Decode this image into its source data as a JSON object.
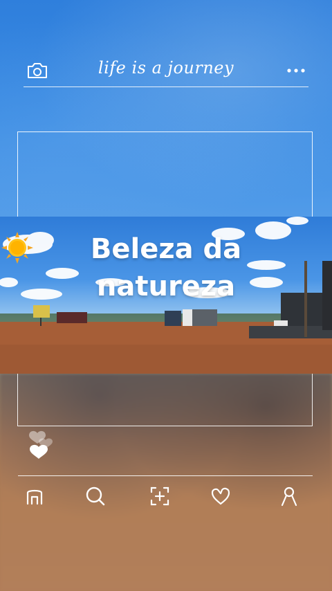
{
  "header": {
    "title": "life is a journey",
    "camera_icon": "camera-icon",
    "menu_icon": "more-horizontal-icon"
  },
  "post": {
    "caption_line1": "Beleza da",
    "caption_line2": "natureza",
    "emoji": "☀️"
  },
  "nav": {
    "items": [
      {
        "icon": "home-icon"
      },
      {
        "icon": "search-icon"
      },
      {
        "icon": "add-post-icon"
      },
      {
        "icon": "heart-icon"
      },
      {
        "icon": "profile-icon"
      }
    ]
  },
  "colors": {
    "sky": "#3a8be3",
    "ground": "#b07d58",
    "line": "#ffffff"
  }
}
